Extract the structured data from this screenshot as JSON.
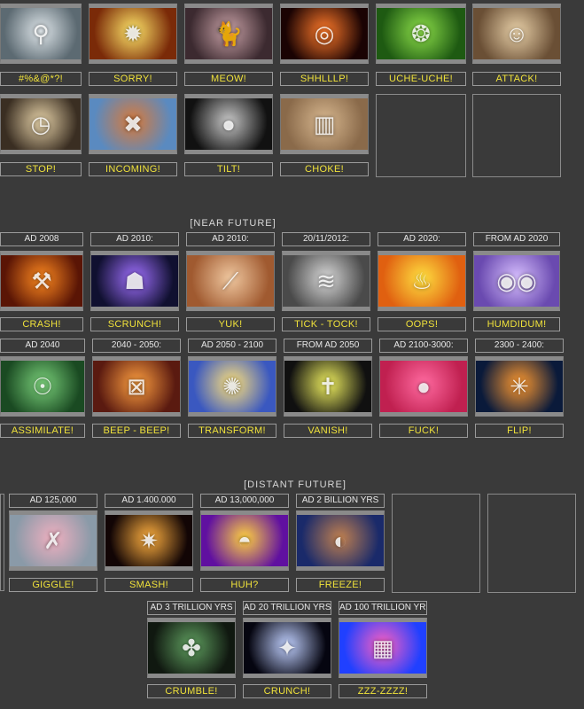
{
  "sections": {
    "near_future": "[NEAR FUTURE]",
    "distant_future": "[DISTANT FUTURE]"
  },
  "tiles": [
    {
      "label": "#%&@*?!",
      "icon": "eiffel-tower-icon",
      "colors": [
        "#dfe6ea",
        "#5c6a72"
      ]
    },
    {
      "label": "SORRY!",
      "icon": "explosion-icon",
      "colors": [
        "#ffe66a",
        "#7a2a08"
      ]
    },
    {
      "label": "MEOW!",
      "icon": "cat-icon",
      "colors": [
        "#caa3a8",
        "#3c2a30"
      ]
    },
    {
      "label": "SHHLLLP!",
      "icon": "black-hole-icon",
      "colors": [
        "#ff7a2a",
        "#1a0303"
      ]
    },
    {
      "label": "UCHE-UCHE!",
      "icon": "cells-icon",
      "colors": [
        "#8ee04a",
        "#1e5a12"
      ]
    },
    {
      "label": "ATTACK!",
      "icon": "portrait-icon",
      "colors": [
        "#e8d0a8",
        "#6a4f35"
      ]
    },
    {
      "label": "STOP!",
      "icon": "clock-icon",
      "colors": [
        "#e6d2a8",
        "#3a2e22"
      ]
    },
    {
      "label": "INCOMING!",
      "icon": "asteroid-icon",
      "colors": [
        "#d97a3a",
        "#5a8ac0"
      ]
    },
    {
      "label": "TILT!",
      "icon": "moon-icon",
      "colors": [
        "#c8c8c8",
        "#111111"
      ]
    },
    {
      "label": "CHOKE!",
      "icon": "smog-city-icon",
      "colors": [
        "#d8b890",
        "#8a6a4a"
      ]
    },
    {
      "date": "AD 2008",
      "label": "CRASH!",
      "icon": "oil-pump-icon",
      "colors": [
        "#ff8a20",
        "#5a1505"
      ]
    },
    {
      "date": "AD 2010:",
      "label": "SCRUNCH!",
      "icon": "robot-face-icon",
      "colors": [
        "#a070ff",
        "#101030"
      ]
    },
    {
      "date": "AD 2010:",
      "label": "YUK!",
      "icon": "wheat-icon",
      "colors": [
        "#f0c8a0",
        "#a05a30"
      ]
    },
    {
      "date": "20/11/2012:",
      "label": "TICK - TOCK!",
      "icon": "brain-icon",
      "colors": [
        "#d8d8d8",
        "#4a4a4a"
      ]
    },
    {
      "date": "AD 2020:",
      "label": "OOPS!",
      "icon": "fire-icon",
      "colors": [
        "#ffe040",
        "#e06010"
      ]
    },
    {
      "date": "FROM AD 2020",
      "label": "HUMDIDUM!",
      "icon": "eyes-icon",
      "colors": [
        "#d8c0ff",
        "#6a4ab0"
      ]
    },
    {
      "date": "AD 2040",
      "label": "ASSIMILATE!",
      "icon": "cyborg-icon",
      "colors": [
        "#7ad07a",
        "#1a4a22"
      ]
    },
    {
      "date": "2040 - 2050:",
      "label": "BEEP - BEEP!",
      "icon": "machine-face-icon",
      "colors": [
        "#ffa040",
        "#5a1a10"
      ]
    },
    {
      "date": "AD 2050 - 2100",
      "label": "TRANSFORM!",
      "icon": "glowing-figure-icon",
      "colors": [
        "#ffe27a",
        "#3a58c0"
      ]
    },
    {
      "date": "FROM AD 2050",
      "label": "VANISH!",
      "icon": "cross-road-icon",
      "colors": [
        "#f0f060",
        "#101010"
      ]
    },
    {
      "date": "AD 2100-3000:",
      "label": "FUCK!",
      "icon": "pink-tissue-icon",
      "colors": [
        "#ff6aa0",
        "#c02050"
      ]
    },
    {
      "date": "2300 - 2400:",
      "label": "FLIP!",
      "icon": "magnetic-field-icon",
      "colors": [
        "#ff9a30",
        "#0a1a3a"
      ]
    },
    {
      "date": "AD 125,000",
      "label": "GIGGLE!",
      "icon": "chromosome-icon",
      "colors": [
        "#f0b0c0",
        "#8a9aa8"
      ]
    },
    {
      "date": "AD 1.400.000",
      "label": "SMASH!",
      "icon": "galaxy-collision-icon",
      "colors": [
        "#ffb040",
        "#120505"
      ]
    },
    {
      "date": "AD 13,000,000",
      "label": "HUH?",
      "icon": "sun-grid-icon",
      "colors": [
        "#ffd040",
        "#6010a0"
      ]
    },
    {
      "date": "AD 2 BILLION YRS",
      "label": "FREEZE!",
      "icon": "earth-cutaway-icon",
      "colors": [
        "#c08050",
        "#1a2a6a"
      ]
    },
    {
      "date": "AD 3 TRILLION YRS",
      "label": "CRUMBLE!",
      "icon": "broken-planet-icon",
      "colors": [
        "#60a060",
        "#101810"
      ]
    },
    {
      "date": "AD 20 TRILLION YRS",
      "label": "CRUNCH!",
      "icon": "starburst-icon",
      "colors": [
        "#c0d0ff",
        "#050510"
      ]
    },
    {
      "date": "AD 100 TRILLION YRS",
      "label": "ZZZ-ZZZZ!",
      "icon": "pixel-face-icon",
      "colors": [
        "#ff60c0",
        "#2040ff"
      ]
    }
  ]
}
